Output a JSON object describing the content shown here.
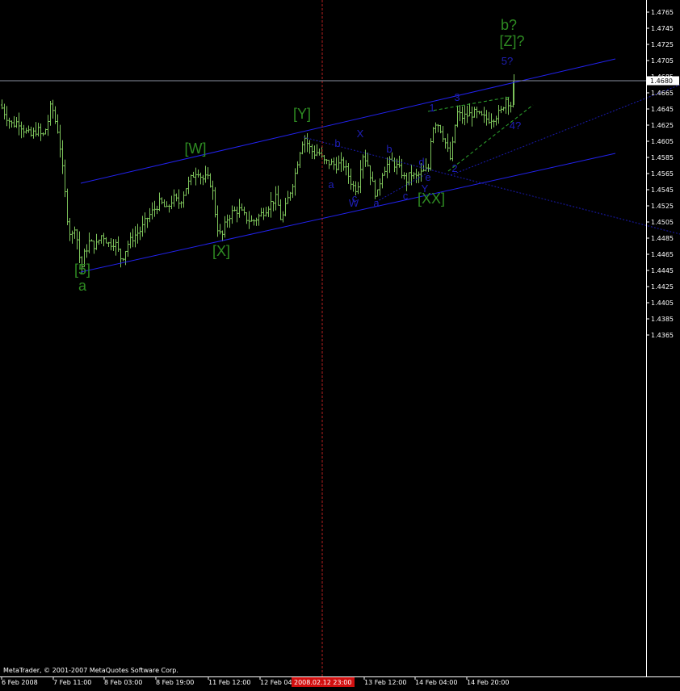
{
  "chart_data": {
    "type": "ohlc",
    "platform_label": "MetaTrader, © 2001-2007 MetaQuotes Software Corp.",
    "current_price": "1.4680",
    "cursor_time_label": "2008.02.12 23:00",
    "colors": {
      "background": "#000000",
      "bars": "#7cc25a",
      "channel": "#2222ee",
      "guide_dashed": "#1a1ab0",
      "green_dashed": "#2ea82e",
      "wave_green": "#2e8b22",
      "wave_blue": "#1f1fb8",
      "cursor_line": "#b52020",
      "axis": "#ffffff",
      "price_line": "#8a8fa0"
    },
    "y_axis": {
      "min": 1.4355,
      "max": 1.4775,
      "ticks": [
        "1.4765",
        "1.4745",
        "1.4725",
        "1.4705",
        "1.4685",
        "1.4665",
        "1.4645",
        "1.4625",
        "1.4605",
        "1.4585",
        "1.4565",
        "1.4545",
        "1.4525",
        "1.4505",
        "1.4485",
        "1.4465",
        "1.4445",
        "1.4425",
        "1.4405",
        "1.4385",
        "1.4365"
      ]
    },
    "x_axis": {
      "ticks": [
        "6 Feb 2008",
        "7 Feb 11:00",
        "8 Feb 03:00",
        "8 Feb 19:00",
        "11 Feb 12:00",
        "12 Feb 04:00",
        "13 Feb 12:00",
        "14 Feb 04:00",
        "14 Feb 20:00"
      ]
    },
    "path_points": [
      [
        0,
        1.465
      ],
      [
        8,
        1.4635
      ],
      [
        15,
        1.4625
      ],
      [
        22,
        1.463
      ],
      [
        30,
        1.4618
      ],
      [
        38,
        1.4612
      ],
      [
        46,
        1.462
      ],
      [
        52,
        1.461
      ],
      [
        58,
        1.4625
      ],
      [
        63,
        1.4652
      ],
      [
        68,
        1.463
      ],
      [
        72,
        1.4615
      ],
      [
        76,
        1.458
      ],
      [
        80,
        1.454
      ],
      [
        84,
        1.45
      ],
      [
        88,
        1.4485
      ],
      [
        92,
        1.45
      ],
      [
        96,
        1.4478
      ],
      [
        100,
        1.4445
      ],
      [
        104,
        1.4465
      ],
      [
        110,
        1.448
      ],
      [
        118,
        1.4475
      ],
      [
        126,
        1.449
      ],
      [
        134,
        1.4478
      ],
      [
        142,
        1.448
      ],
      [
        150,
        1.4458
      ],
      [
        158,
        1.4478
      ],
      [
        166,
        1.4488
      ],
      [
        174,
        1.4495
      ],
      [
        182,
        1.451
      ],
      [
        190,
        1.452
      ],
      [
        198,
        1.453
      ],
      [
        206,
        1.452
      ],
      [
        214,
        1.4535
      ],
      [
        222,
        1.4528
      ],
      [
        230,
        1.4548
      ],
      [
        238,
        1.4562
      ],
      [
        244,
        1.457
      ],
      [
        250,
        1.4558
      ],
      [
        256,
        1.456
      ],
      [
        262,
        1.455
      ],
      [
        268,
        1.45
      ],
      [
        274,
        1.4485
      ],
      [
        280,
        1.4508
      ],
      [
        288,
        1.4518
      ],
      [
        296,
        1.452
      ],
      [
        304,
        1.451
      ],
      [
        312,
        1.4505
      ],
      [
        320,
        1.4512
      ],
      [
        328,
        1.452
      ],
      [
        336,
        1.453
      ],
      [
        342,
        1.4535
      ],
      [
        348,
        1.4505
      ],
      [
        352,
        1.452
      ],
      [
        358,
        1.454
      ],
      [
        364,
        1.456
      ],
      [
        370,
        1.459
      ],
      [
        376,
        1.4612
      ],
      [
        382,
        1.4598
      ],
      [
        388,
        1.459
      ],
      [
        394,
        1.4592
      ],
      [
        400,
        1.458
      ],
      [
        408,
        1.4578
      ],
      [
        416,
        1.4575
      ],
      [
        424,
        1.4578
      ],
      [
        430,
        1.4565
      ],
      [
        436,
        1.455
      ],
      [
        442,
        1.4545
      ],
      [
        448,
        1.459
      ],
      [
        454,
        1.458
      ],
      [
        460,
        1.4555
      ],
      [
        466,
        1.4535
      ],
      [
        472,
        1.4565
      ],
      [
        478,
        1.4575
      ],
      [
        484,
        1.458
      ],
      [
        490,
        1.4575
      ],
      [
        496,
        1.4568
      ],
      [
        502,
        1.4555
      ],
      [
        508,
        1.4565
      ],
      [
        514,
        1.456
      ],
      [
        520,
        1.4565
      ],
      [
        526,
        1.4568
      ],
      [
        530,
        1.4572
      ],
      [
        534,
        1.462
      ],
      [
        540,
        1.463
      ],
      [
        546,
        1.4618
      ],
      [
        552,
        1.46
      ],
      [
        558,
        1.458
      ],
      [
        562,
        1.462
      ],
      [
        566,
        1.464
      ],
      [
        572,
        1.4635
      ],
      [
        580,
        1.4638
      ],
      [
        588,
        1.464
      ],
      [
        596,
        1.4635
      ],
      [
        604,
        1.4632
      ],
      [
        612,
        1.4635
      ],
      [
        620,
        1.4642
      ],
      [
        626,
        1.4658
      ],
      [
        632,
        1.465
      ],
      [
        637,
        1.4688
      ]
    ],
    "wave_labels_green": [
      {
        "text": "a",
        "price": 1.442,
        "t": 102
      },
      {
        "text": "[5]",
        "price": 1.444,
        "t": 102
      },
      {
        "text": "[X]",
        "price": 1.4463,
        "t": 274
      },
      {
        "text": "[W]",
        "price": 1.459,
        "t": 242
      },
      {
        "text": "[Y]",
        "price": 1.4633,
        "t": 374
      },
      {
        "text": "[XX]",
        "price": 1.4528,
        "t": 534
      },
      {
        "text": "[Z]?",
        "price": 1.4723,
        "t": 634
      },
      {
        "text": "b?",
        "price": 1.4743,
        "t": 630
      }
    ],
    "wave_labels_blue": [
      {
        "text": "a",
        "price": 1.4547,
        "t": 410
      },
      {
        "text": "b",
        "price": 1.4598,
        "t": 418
      },
      {
        "text": "c",
        "price": 1.453,
        "t": 439
      },
      {
        "text": "W",
        "price": 1.4524,
        "t": 438
      },
      {
        "text": "X",
        "price": 1.461,
        "t": 446
      },
      {
        "text": "a",
        "price": 1.4524,
        "t": 466
      },
      {
        "text": "b",
        "price": 1.4591,
        "t": 482
      },
      {
        "text": "c",
        "price": 1.4533,
        "t": 502
      },
      {
        "text": "d",
        "price": 1.4575,
        "t": 522
      },
      {
        "text": "e",
        "price": 1.4556,
        "t": 530
      },
      {
        "text": "Y",
        "price": 1.4542,
        "t": 526
      },
      {
        "text": "1",
        "price": 1.4642,
        "t": 535
      },
      {
        "text": "2",
        "price": 1.4567,
        "t": 563
      },
      {
        "text": "3",
        "price": 1.4655,
        "t": 566
      },
      {
        "text": "4?",
        "price": 1.462,
        "t": 638
      },
      {
        "text": "5?",
        "price": 1.47,
        "t": 628
      }
    ],
    "channel_lines": [
      {
        "from": [
          100,
          1.4553
        ],
        "to": [
          762,
          1.4707
        ],
        "style": "solid"
      },
      {
        "from": [
          100,
          1.4443
        ],
        "to": [
          762,
          1.459
        ],
        "style": "solid"
      },
      {
        "from": [
          376,
          1.461
        ],
        "to": [
          842,
          1.449
        ],
        "style": "dotted"
      },
      {
        "from": [
          558,
          1.4563
        ],
        "to": [
          842,
          1.4675
        ],
        "style": "dotted"
      },
      {
        "from": [
          530,
          1.4642
        ],
        "to": [
          632,
          1.466
        ],
        "style": "green-dashed"
      },
      {
        "from": [
          555,
          1.4568
        ],
        "to": [
          660,
          1.465
        ],
        "style": "green-dashed"
      },
      {
        "from": [
          466,
          1.453
        ],
        "to": [
          530,
          1.4566
        ],
        "style": "dotted"
      }
    ]
  }
}
